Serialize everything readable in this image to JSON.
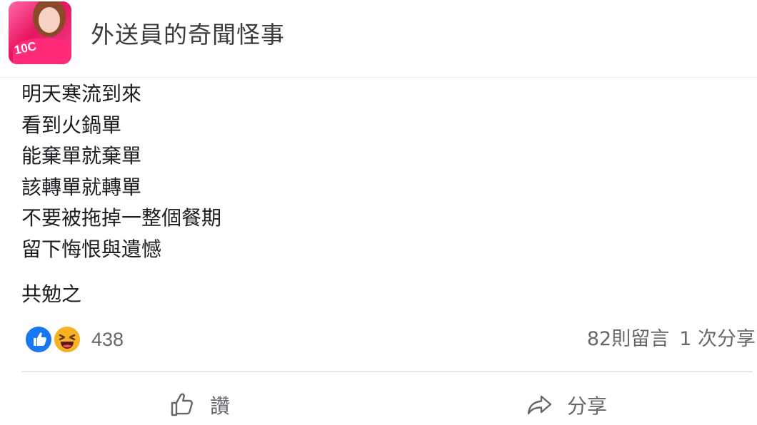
{
  "header": {
    "page_name": "外送員的奇聞怪事",
    "avatar_text": "10C"
  },
  "post": {
    "lines": [
      "明天寒流到來",
      "看到火鍋單",
      "能棄單就棄單",
      "該轉單就轉單",
      "不要被拖掉一整個餐期",
      "留下悔恨與遺憾"
    ],
    "closing": "共勉之"
  },
  "stats": {
    "reactions": [
      "like-icon",
      "haha-icon"
    ],
    "reaction_count": "438",
    "comments": "82則留言",
    "shares": "1 次分享"
  },
  "actions": {
    "like_label": "讚",
    "share_label": "分享"
  },
  "colors": {
    "like_blue": "#1877f2",
    "haha_yellow": "#f7b125",
    "secondary_text": "#65676b",
    "divider": "#e4e6eb"
  }
}
